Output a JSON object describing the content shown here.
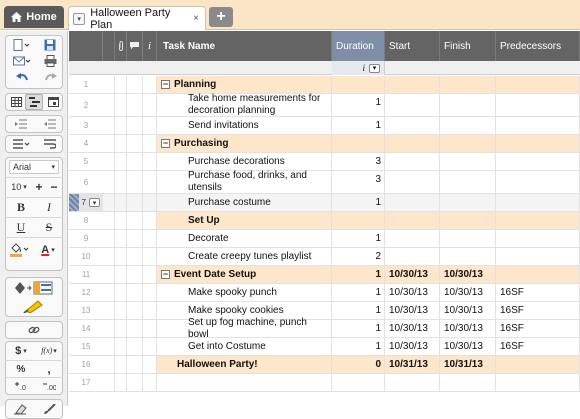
{
  "tabs": {
    "home_label": "Home",
    "doc_title": "Halloween Party Plan",
    "close": "×",
    "add": "+",
    "menu_glyph": "▾"
  },
  "toolbar": {
    "font_name": "Arial",
    "font_size": "10",
    "plus": "+",
    "minus": "−",
    "bold": "B",
    "italic": "I",
    "underline": "U",
    "strike": "S",
    "text_color": "A",
    "currency": "$",
    "fx": "f(x)",
    "percent": "%",
    "comma": ",",
    "dec_more": ".0",
    "dec_less": ".00"
  },
  "columns": {
    "info": "i",
    "task": "Task Name",
    "duration": "Duration",
    "start": "Start",
    "finish": "Finish",
    "predecessors": "Predecessors"
  },
  "rows": [
    {
      "num": "1",
      "task": "Planning",
      "duration": "",
      "start": "",
      "finish": "",
      "pred": "",
      "type": "group"
    },
    {
      "num": "2",
      "task": "Take home measurements for decoration planning",
      "duration": "1",
      "start": "",
      "finish": "",
      "pred": "",
      "type": "task"
    },
    {
      "num": "3",
      "task": "Send invitations",
      "duration": "1",
      "start": "",
      "finish": "",
      "pred": "",
      "type": "task"
    },
    {
      "num": "4",
      "task": "Purchasing",
      "duration": "",
      "start": "",
      "finish": "",
      "pred": "",
      "type": "group"
    },
    {
      "num": "5",
      "task": "Purchase decorations",
      "duration": "3",
      "start": "",
      "finish": "",
      "pred": "",
      "type": "task"
    },
    {
      "num": "6",
      "task": "Purchase food, drinks, and utensils",
      "duration": "3",
      "start": "",
      "finish": "",
      "pred": "",
      "type": "task"
    },
    {
      "num": "7",
      "task": "Purchase costume",
      "duration": "1",
      "start": "",
      "finish": "",
      "pred": "",
      "type": "selected"
    },
    {
      "num": "8",
      "task": "Set Up",
      "duration": "",
      "start": "",
      "finish": "",
      "pred": "",
      "type": "subgroup"
    },
    {
      "num": "9",
      "task": "Decorate",
      "duration": "1",
      "start": "",
      "finish": "",
      "pred": "",
      "type": "task"
    },
    {
      "num": "10",
      "task": "Create creepy tunes playlist",
      "duration": "2",
      "start": "",
      "finish": "",
      "pred": "",
      "type": "task"
    },
    {
      "num": "11",
      "task": "Event Date Setup",
      "duration": "1",
      "start": "10/30/13",
      "finish": "10/30/13",
      "pred": "",
      "type": "group"
    },
    {
      "num": "12",
      "task": "Make spooky punch",
      "duration": "1",
      "start": "10/30/13",
      "finish": "10/30/13",
      "pred": "16SF",
      "type": "task"
    },
    {
      "num": "13",
      "task": "Make spooky cookies",
      "duration": "1",
      "start": "10/30/13",
      "finish": "10/30/13",
      "pred": "16SF",
      "type": "task"
    },
    {
      "num": "14",
      "task": "Set up fog machine, punch bowl",
      "duration": "1",
      "start": "10/30/13",
      "finish": "10/30/13",
      "pred": "16SF",
      "type": "task"
    },
    {
      "num": "15",
      "task": "Get into Costume",
      "duration": "1",
      "start": "10/30/13",
      "finish": "10/30/13",
      "pred": "16SF",
      "type": "task"
    },
    {
      "num": "16",
      "task": "Halloween Party!",
      "duration": "0",
      "start": "10/31/13",
      "finish": "10/31/13",
      "pred": "",
      "type": "milestone"
    },
    {
      "num": "17",
      "task": "",
      "duration": "",
      "start": "",
      "finish": "",
      "pred": "",
      "type": "empty"
    }
  ],
  "colors": {
    "tabbar_bg": "#fbe5c7",
    "group_row_bg": "#fde6c9",
    "header_bg": "#646464",
    "header_selected_bg": "#7d8ea6"
  }
}
